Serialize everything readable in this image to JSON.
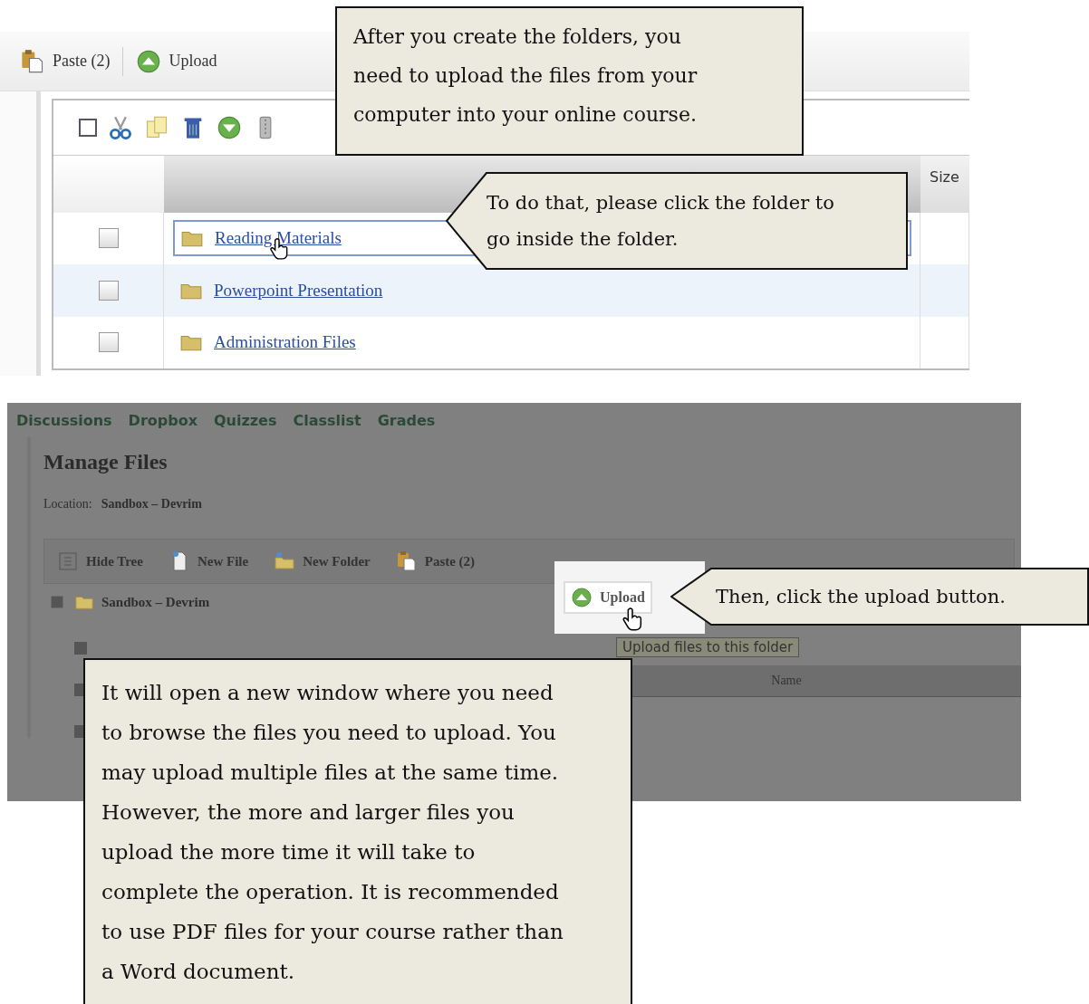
{
  "file_screenshot": {
    "toolbar": [
      {
        "kind": "paste",
        "label": "Paste (2)"
      },
      {
        "kind": "upload",
        "label": "Upload"
      }
    ],
    "select_all": {
      "checked": false
    },
    "size_column": "Size",
    "rows": [
      {
        "name": "Reading Materials",
        "selected": true,
        "checked": false
      },
      {
        "name": "Powerpoint Presentation",
        "selected": false,
        "checked": false
      },
      {
        "name": "Administration Files",
        "selected": false,
        "checked": false
      }
    ]
  },
  "course_screenshot": {
    "nav": [
      "Discussions",
      "Dropbox",
      "Quizzes",
      "Classlist",
      "Grades"
    ],
    "heading": "Manage Files",
    "location_label": "Location:",
    "location_value": "Sandbox – Devrim",
    "toolbar": [
      {
        "kind": "tree",
        "label": "Hide Tree",
        "highlighted": false
      },
      {
        "kind": "file",
        "label": "New File",
        "highlighted": false
      },
      {
        "kind": "folder",
        "label": "New Folder",
        "highlighted": false
      },
      {
        "kind": "paste",
        "label": "Paste (2)",
        "highlighted": false
      },
      {
        "kind": "upload",
        "label": "Upload",
        "highlighted": true
      }
    ],
    "tree_root": "Sandbox – Devrim",
    "tooltip": "Upload files to this folder",
    "name_column": "Name"
  },
  "callouts": [
    {
      "kind": "box",
      "text": "After you create the folders, you need to upload the files from your computer into your online course."
    },
    {
      "kind": "arrow",
      "text": "To do that, please click the folder to go inside the folder."
    },
    {
      "kind": "arrow",
      "text": "Then, click the upload button."
    },
    {
      "kind": "box",
      "text": "It will open a new window where you need to browse the files you need to upload. You may upload multiple files at the same time. However, the more and larger files you upload the more time it will take to complete the operation. It is recommended to use PDF files for your course rather than a Word document."
    }
  ]
}
